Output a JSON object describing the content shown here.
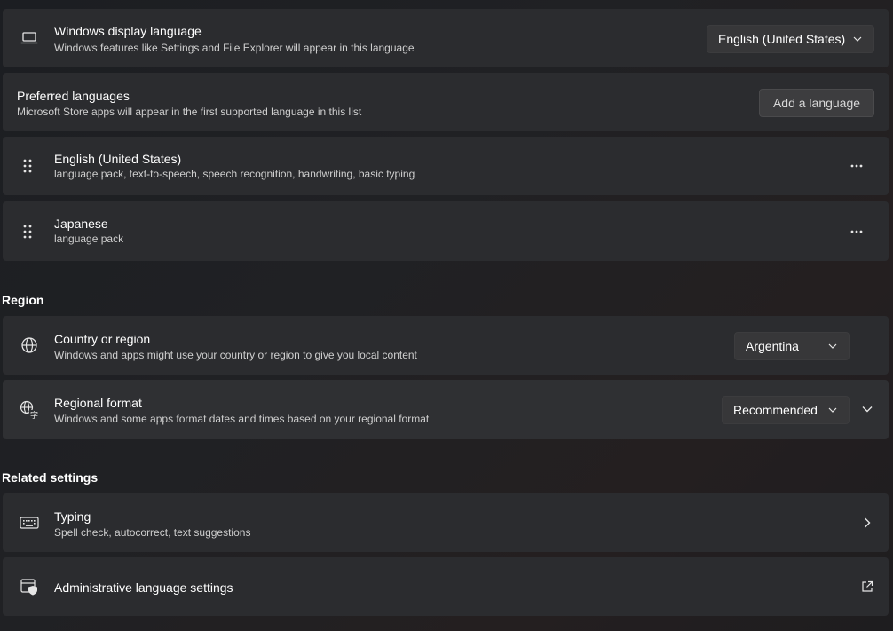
{
  "display_language": {
    "title": "Windows display language",
    "description": "Windows features like Settings and File Explorer will appear in this language",
    "selected": "English (United States)",
    "icon": "laptop-icon"
  },
  "preferred_languages": {
    "title": "Preferred languages",
    "description": "Microsoft Store apps will appear in the first supported language in this list",
    "add_button": "Add a language",
    "items": [
      {
        "name": "English (United States)",
        "features": "language pack, text-to-speech, speech recognition, handwriting, basic typing"
      },
      {
        "name": "Japanese",
        "features": "language pack"
      }
    ]
  },
  "region": {
    "heading": "Region",
    "country": {
      "title": "Country or region",
      "description": "Windows and apps might use your country or region to give you local content",
      "selected": "Argentina",
      "icon": "globe-icon"
    },
    "format": {
      "title": "Regional format",
      "description": "Windows and some apps format dates and times based on your regional format",
      "selected": "Recommended",
      "icon": "language-format-icon"
    }
  },
  "related": {
    "heading": "Related settings",
    "typing": {
      "title": "Typing",
      "description": "Spell check, autocorrect, text suggestions",
      "icon": "keyboard-icon"
    },
    "admin": {
      "title": "Administrative language settings",
      "icon": "admin-shield-icon"
    }
  }
}
